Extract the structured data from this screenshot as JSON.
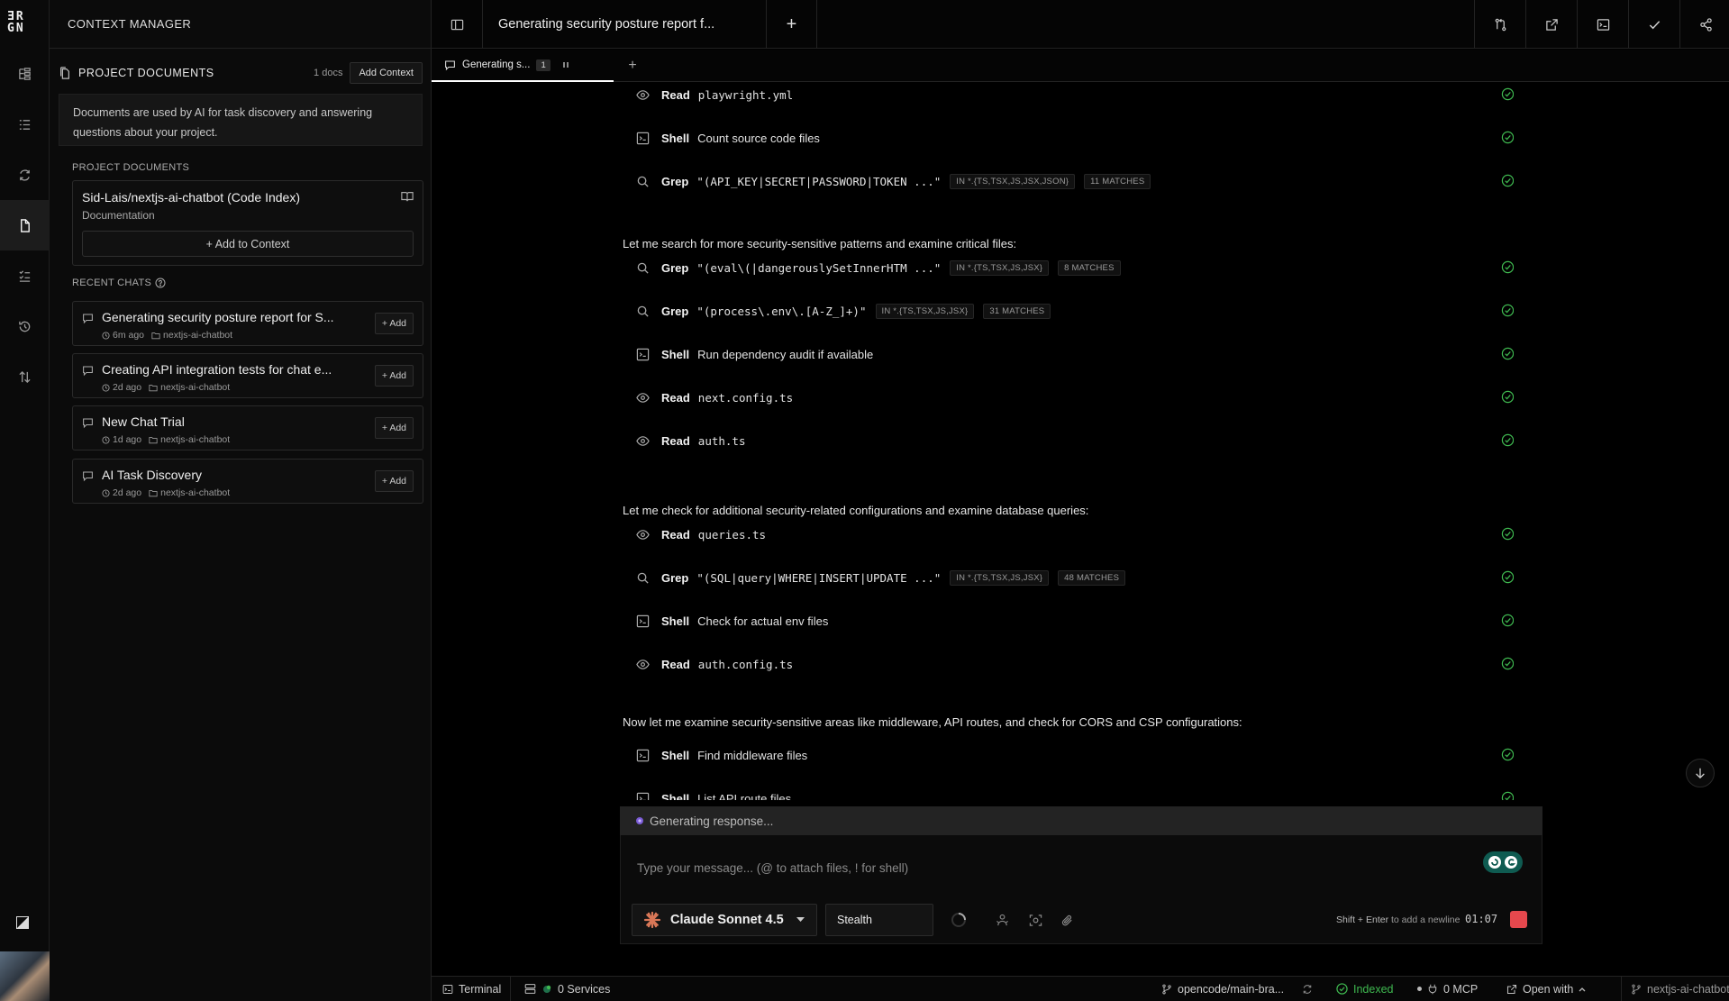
{
  "app": {
    "logo_text_line1": "ƎR",
    "logo_text_line2": "GN",
    "panel_title": "CONTEXT MANAGER"
  },
  "rail": {
    "items": [
      "tree-view",
      "list-view",
      "refresh-view",
      "documents",
      "checklist",
      "history",
      "sort"
    ]
  },
  "context": {
    "section_title": "PROJECT DOCUMENTS",
    "docs_count": "1 docs",
    "add_context_label": "Add Context",
    "info_text": "Documents are used by AI for task discovery and answering questions about your project.",
    "docs_label": "PROJECT DOCUMENTS",
    "doc": {
      "title": "Sid-Lais/nextjs-ai-chatbot (Code Index)",
      "subtitle": "Documentation",
      "add_label": "+ Add to Context"
    },
    "recent_label": "RECENT CHATS",
    "chats": [
      {
        "title": "Generating security posture report for S...",
        "time": "6m ago",
        "project": "nextjs-ai-chatbot",
        "add": "+ Add"
      },
      {
        "title": "Creating API integration tests for chat e...",
        "time": "2d ago",
        "project": "nextjs-ai-chatbot",
        "add": "+ Add"
      },
      {
        "title": "New Chat Trial",
        "time": "1d ago",
        "project": "nextjs-ai-chatbot",
        "add": "+ Add"
      },
      {
        "title": "AI Task Discovery",
        "time": "2d ago",
        "project": "nextjs-ai-chatbot",
        "add": "+ Add"
      }
    ]
  },
  "topbar": {
    "title": "Generating security posture report f...",
    "new_label": "+"
  },
  "tabs": {
    "active_label": "Generating s...",
    "active_badge": "1",
    "add": "+"
  },
  "transcript": {
    "rows": [
      {
        "icon": "eye-icon",
        "tool": "Read",
        "target": "playwright.yml",
        "mono": true
      },
      {
        "icon": "terminal-icon",
        "tool": "Shell",
        "target": "Count source code files",
        "mono": false
      },
      {
        "icon": "search-icon",
        "tool": "Grep",
        "target": "\"(API_KEY|SECRET|PASSWORD|TOKEN ...\"",
        "mono": true,
        "scope": "IN *.{TS,TSX,JS,JSX,JSON}",
        "matches": "11 MATCHES"
      },
      {
        "icon": "search-icon",
        "tool": "Grep",
        "target": "\"(eval\\(|dangerouslySetInnerHTM ...\"",
        "mono": true,
        "scope": "IN *.{TS,TSX,JS,JSX}",
        "matches": "8 MATCHES"
      },
      {
        "icon": "search-icon",
        "tool": "Grep",
        "target": "\"(process\\.env\\.[A-Z_]+)\"",
        "mono": true,
        "scope": "IN *.{TS,TSX,JS,JSX}",
        "matches": "31 MATCHES"
      },
      {
        "icon": "terminal-icon",
        "tool": "Shell",
        "target": "Run dependency audit if available",
        "mono": false
      },
      {
        "icon": "eye-icon",
        "tool": "Read",
        "target": "next.config.ts",
        "mono": true
      },
      {
        "icon": "eye-icon",
        "tool": "Read",
        "target": "auth.ts",
        "mono": true
      },
      {
        "icon": "eye-icon",
        "tool": "Read",
        "target": "queries.ts",
        "mono": true
      },
      {
        "icon": "search-icon",
        "tool": "Grep",
        "target": "\"(SQL|query|WHERE|INSERT|UPDATE ...\"",
        "mono": true,
        "scope": "IN *.{TS,TSX,JS,JSX}",
        "matches": "48 MATCHES"
      },
      {
        "icon": "terminal-icon",
        "tool": "Shell",
        "target": "Check for actual env files",
        "mono": false
      },
      {
        "icon": "eye-icon",
        "tool": "Read",
        "target": "auth.config.ts",
        "mono": true
      },
      {
        "icon": "terminal-icon",
        "tool": "Shell",
        "target": "Find middleware files",
        "mono": false
      },
      {
        "icon": "terminal-icon",
        "tool": "Shell",
        "target": "List API route files",
        "mono": false
      }
    ],
    "messages": [
      "Let me search for more security-sensitive patterns and examine critical files:",
      "Let me check for additional security-related configurations and examine database queries:",
      "Now let me examine security-sensitive areas like middleware, API routes, and check for CORS and CSP configurations:"
    ]
  },
  "composer": {
    "status": "Generating response...",
    "placeholder": "Type your message... (@ to attach files, ! for shell)",
    "model": "Claude Sonnet 4.5",
    "mode": "Stealth",
    "hint_keys": "Shift + Enter",
    "hint_text": "to add a newline",
    "timer": "01:07"
  },
  "statusbar": {
    "terminal": "Terminal",
    "services": "0 Services",
    "branch": "opencode/main-bra...",
    "indexed": "Indexed",
    "mcp": "0 MCP",
    "open_with": "Open with",
    "repo": "nextjs-ai-chatbot"
  },
  "colors": {
    "accent_green": "#3fb950",
    "stop_red": "#e5484d",
    "claude_orange": "#d97757"
  }
}
